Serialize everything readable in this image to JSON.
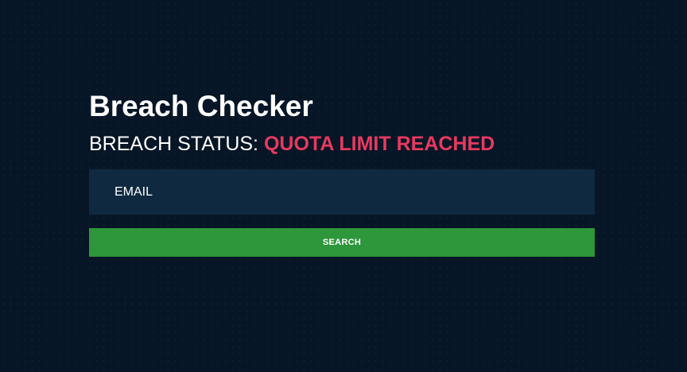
{
  "app": {
    "title": "Breach Checker"
  },
  "status": {
    "label": "BREACH STATUS:",
    "value": "QUOTA LIMIT REACHED",
    "value_color": "#e8395f"
  },
  "search": {
    "placeholder": "EMAIL",
    "value": "",
    "button_label": "SEARCH"
  },
  "colors": {
    "background": "#071626",
    "input_background": "#0f2a40",
    "button": "#2e963b",
    "text": "#ffffff"
  }
}
